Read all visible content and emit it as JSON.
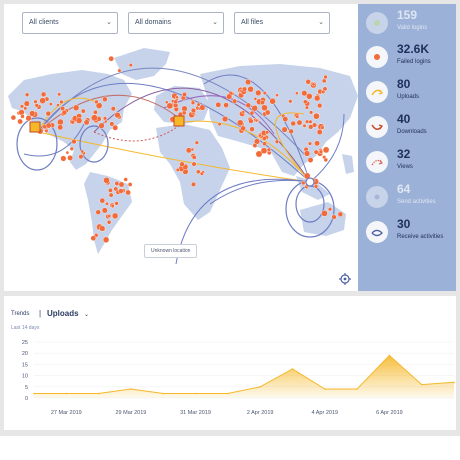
{
  "filters": {
    "clients": "All clients",
    "domains": "All domains",
    "files": "All files"
  },
  "map": {
    "unknown_location": "Unknown location"
  },
  "stats": [
    {
      "value": "159",
      "label": "Valid logins",
      "icon": "circle-check-icon",
      "dim": true
    },
    {
      "value": "32.6K",
      "label": "Failed logins",
      "icon": "failed-login-icon",
      "dim": false
    },
    {
      "value": "80",
      "label": "Uploads",
      "icon": "upload-arrow-icon",
      "dim": false
    },
    {
      "value": "40",
      "label": "Downloads",
      "icon": "download-arrow-icon",
      "dim": false
    },
    {
      "value": "32",
      "label": "Views",
      "icon": "view-arrow-icon",
      "dim": false
    },
    {
      "value": "64",
      "label": "Send activities",
      "icon": "send-icon",
      "dim": true
    },
    {
      "value": "30",
      "label": "Receive activities",
      "icon": "receive-icon",
      "dim": false
    }
  ],
  "trends": {
    "label": "Trends",
    "separator": "|",
    "metric": "Uploads",
    "range": "Last 14 days"
  },
  "colors": {
    "accent": "#f5b829",
    "sidebar": "#9bb1d8",
    "dots": "#f26b3a",
    "land": "#c6d3ea"
  },
  "chart_data": {
    "type": "area",
    "x": [
      "26 Mar 2019",
      "27 Mar 2019",
      "28 Mar 2019",
      "29 Mar 2019",
      "30 Mar 2019",
      "31 Mar 2019",
      "1 Apr 2019",
      "2 Apr 2019",
      "3 Apr 2019",
      "4 Apr 2019",
      "5 Apr 2019",
      "6 Apr 2019",
      "7 Apr 2019",
      "8 Apr 2019"
    ],
    "values": [
      2,
      2,
      2,
      4,
      2,
      2,
      2,
      5,
      13,
      4,
      4,
      19,
      6,
      7
    ],
    "xticks": [
      "27 Mar 2019",
      "29 Mar 2019",
      "31 Mar 2019",
      "2 Apr 2019",
      "4 Apr 2019",
      "6 Apr 2019"
    ],
    "yticks": [
      0,
      5,
      10,
      15,
      20,
      25
    ],
    "ylim": [
      0,
      25
    ],
    "title": "",
    "xlabel": "",
    "ylabel": ""
  }
}
